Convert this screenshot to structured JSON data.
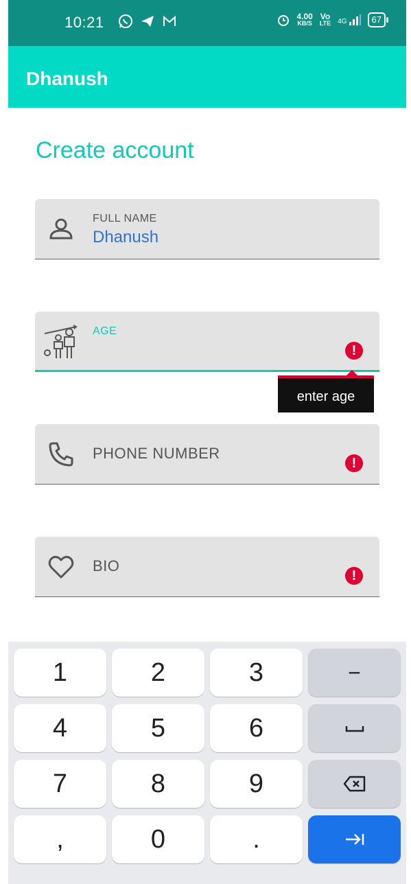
{
  "status_bar": {
    "time": "10:21",
    "speed_value": "4.00",
    "speed_unit": "KB/S",
    "volte_top": "Vo",
    "volte_bottom": "LTE",
    "network": "4G",
    "battery": "67"
  },
  "app_bar": {
    "title": "Dhanush"
  },
  "page": {
    "title": "Create account"
  },
  "form": {
    "full_name": {
      "label": "FULL NAME",
      "value": "Dhanush"
    },
    "age": {
      "label": "AGE",
      "error_tooltip": "enter age"
    },
    "phone": {
      "label": "PHONE NUMBER"
    },
    "bio": {
      "label": "BIO"
    },
    "error_symbol": "!"
  },
  "keyboard": {
    "rows": [
      [
        "1",
        "2",
        "3",
        "−"
      ],
      [
        "4",
        "5",
        "6",
        "␣"
      ],
      [
        "7",
        "8",
        "9",
        "⌫"
      ],
      [
        ",",
        "0",
        ".",
        "→|"
      ]
    ]
  },
  "colors": {
    "status_bar": "#0f8f84",
    "app_bar": "#03dac5",
    "accent": "#12c8b6",
    "error": "#e00034",
    "keyboard_action": "#1a73e8"
  }
}
